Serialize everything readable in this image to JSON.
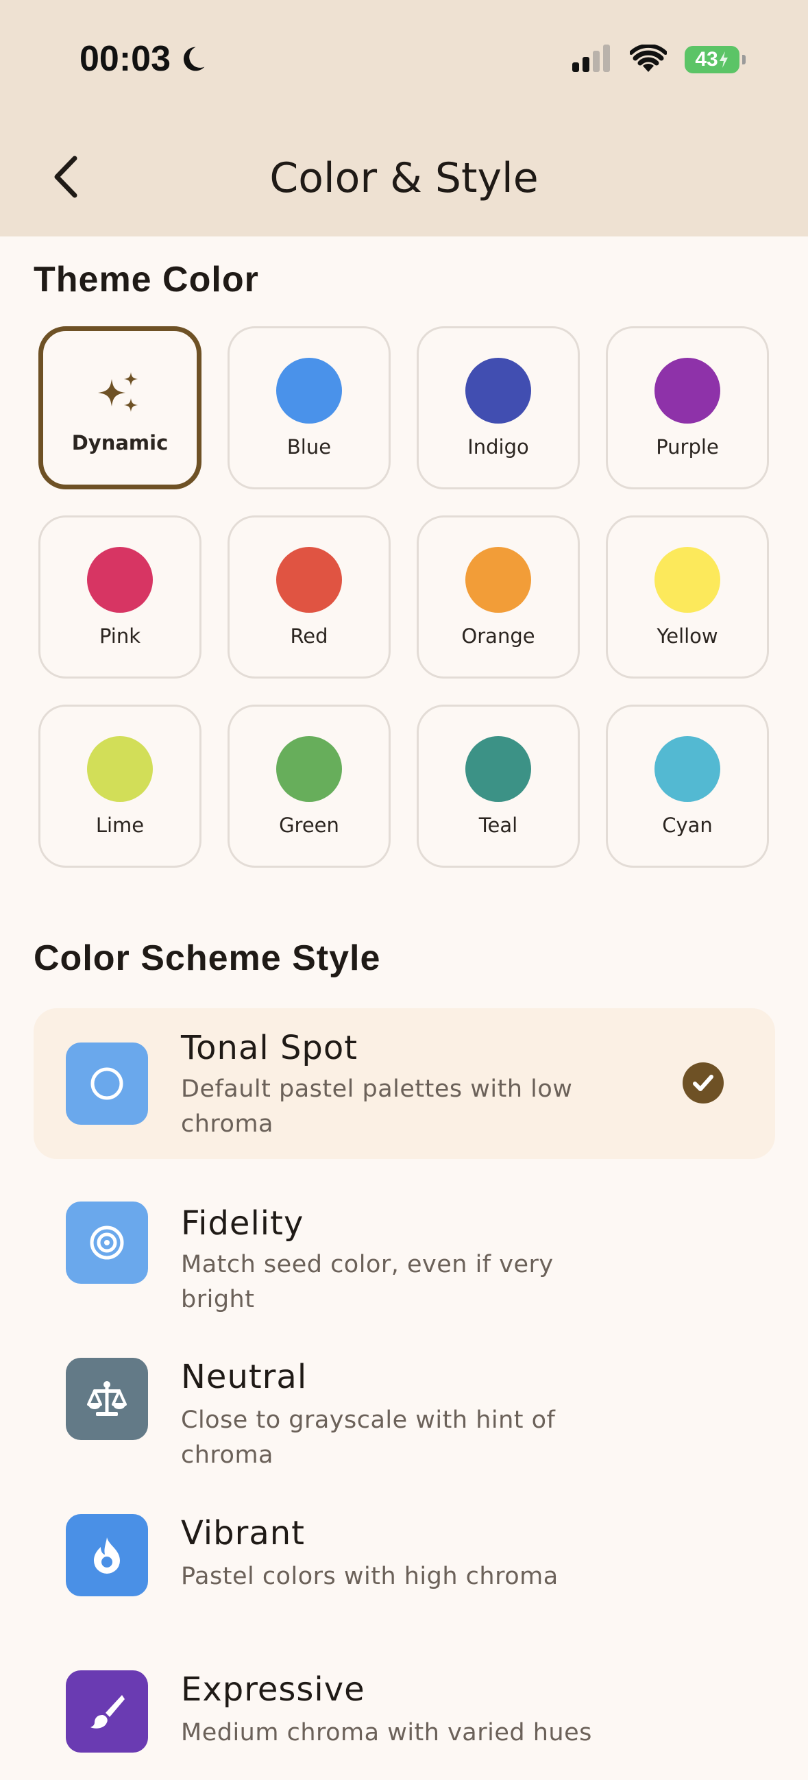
{
  "status_bar": {
    "time": "00:03",
    "battery": "43"
  },
  "header": {
    "title": "Color & Style"
  },
  "theme_color": {
    "title": "Theme Color",
    "options": [
      {
        "label": "Dynamic",
        "color": "#6E5125",
        "selected": true,
        "icon": "sparkle-icon"
      },
      {
        "label": "Blue",
        "color": "#4A92EA"
      },
      {
        "label": "Indigo",
        "color": "#414EB1"
      },
      {
        "label": "Purple",
        "color": "#8E32A9"
      },
      {
        "label": "Pink",
        "color": "#D73563"
      },
      {
        "label": "Red",
        "color": "#E05442"
      },
      {
        "label": "Orange",
        "color": "#F29D38"
      },
      {
        "label": "Yellow",
        "color": "#FCE95B"
      },
      {
        "label": "Lime",
        "color": "#D2DE58"
      },
      {
        "label": "Green",
        "color": "#67AE5B"
      },
      {
        "label": "Teal",
        "color": "#3C9286"
      },
      {
        "label": "Cyan",
        "color": "#53B9D2"
      }
    ]
  },
  "scheme_style": {
    "title": "Color Scheme Style",
    "items": [
      {
        "name": "Tonal Spot",
        "description": "Default pastel palettes with low chroma",
        "icon": "circle-outline-icon",
        "icon_color": "#6AA8EC",
        "selected": true
      },
      {
        "name": "Fidelity",
        "description": "Match seed color, even if very bright",
        "icon": "target-icon",
        "icon_color": "#6AA8EC"
      },
      {
        "name": "Neutral",
        "description": "Close to grayscale with hint of chroma",
        "icon": "balance-scale-icon",
        "icon_color": "#637A87"
      },
      {
        "name": "Vibrant",
        "description": "Pastel colors with high chroma",
        "icon": "flame-icon",
        "icon_color": "#4A90E6"
      },
      {
        "name": "Expressive",
        "description": "Medium chroma with varied hues",
        "icon": "brush-icon",
        "icon_color": "#6A3BB2"
      }
    ]
  }
}
